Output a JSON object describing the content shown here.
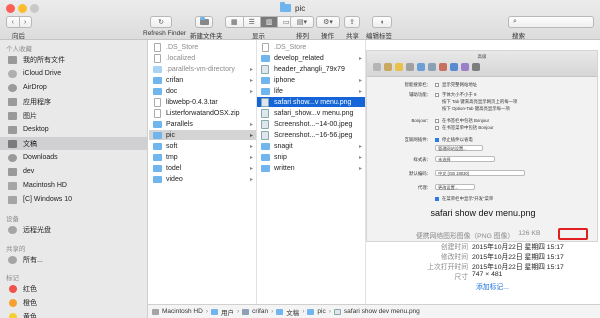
{
  "window": {
    "title": "pic"
  },
  "toolbar": {
    "back_label": "向后",
    "refresh_label": "Refresh Finder",
    "new_folder_label": "新建文件夹",
    "display_label": "显示",
    "arrange_label": "排列",
    "action_label": "操作",
    "share_label": "共享",
    "edit_tags_label": "编辑标签",
    "search_label": "搜索"
  },
  "sidebar": {
    "favorites_title": "个人收藏",
    "favorites": [
      {
        "label": "我的所有文件",
        "icon": "all-files-icon"
      },
      {
        "label": "iCloud Drive",
        "icon": "cloud-icon"
      },
      {
        "label": "AirDrop",
        "icon": "airdrop-icon"
      },
      {
        "label": "应用程序",
        "icon": "applications-icon"
      },
      {
        "label": "图片",
        "icon": "pictures-icon"
      },
      {
        "label": "Desktop",
        "icon": "desktop-icon"
      },
      {
        "label": "文稿",
        "icon": "documents-icon"
      },
      {
        "label": "Downloads",
        "icon": "downloads-icon"
      },
      {
        "label": "dev",
        "icon": "folder-icon"
      },
      {
        "label": "Macintosh HD",
        "icon": "disk-icon"
      },
      {
        "label": "[C] Windows 10",
        "icon": "disk-icon"
      }
    ],
    "devices_title": "设备",
    "devices": [
      {
        "label": "远程光盘",
        "icon": "remote-disc-icon"
      }
    ],
    "shared_title": "共享的",
    "shared": [
      {
        "label": "所有...",
        "icon": "network-icon"
      }
    ],
    "tags_title": "标记",
    "tags": [
      {
        "label": "红色",
        "color": "#f0524c"
      },
      {
        "label": "橙色",
        "color": "#f5a030"
      },
      {
        "label": "黄色",
        "color": "#f5cf32"
      }
    ]
  },
  "columns": {
    "col1": [
      {
        "name": ".DS_Store",
        "kind": "file",
        "dim": true
      },
      {
        "name": ".localized",
        "kind": "file",
        "dim": true
      },
      {
        "name": ".parallels-vm-directory",
        "kind": "folder",
        "dim": true
      },
      {
        "name": "crifan",
        "kind": "folder"
      },
      {
        "name": "doc",
        "kind": "folder"
      },
      {
        "name": "libwebp-0.4.3.tar",
        "kind": "file"
      },
      {
        "name": "ListerforwatandOSX.zip",
        "kind": "file"
      },
      {
        "name": "Parallels",
        "kind": "folder"
      },
      {
        "name": "pic",
        "kind": "folder",
        "selected": true
      },
      {
        "name": "soft",
        "kind": "folder"
      },
      {
        "name": "tmp",
        "kind": "folder"
      },
      {
        "name": "todel",
        "kind": "folder"
      },
      {
        "name": "video",
        "kind": "folder"
      }
    ],
    "col2": [
      {
        "name": ".DS_Store",
        "kind": "file",
        "dim": true
      },
      {
        "name": "develop_related",
        "kind": "folder"
      },
      {
        "name": "header_zhangli_79x79",
        "kind": "img"
      },
      {
        "name": "iphone",
        "kind": "folder"
      },
      {
        "name": "life",
        "kind": "folder"
      },
      {
        "name": "safari show...v menu.png",
        "kind": "img",
        "selected": true
      },
      {
        "name": "safari_show...v menu.png",
        "kind": "img"
      },
      {
        "name": "Screenshot...~14-00.jpeg",
        "kind": "img"
      },
      {
        "name": "Screenshot...~16-56.jpeg",
        "kind": "img"
      },
      {
        "name": "snagit",
        "kind": "folder"
      },
      {
        "name": "snip",
        "kind": "folder"
      },
      {
        "name": "written",
        "kind": "folder"
      }
    ]
  },
  "preview_thumb": {
    "title": "高级",
    "rows": [
      {
        "label": "智能搜索栏：",
        "value": "显示完整网站地址"
      },
      {
        "label": "辅助功能：",
        "value": "字体大小不小于 9"
      },
      {
        "label": "",
        "value": "按下 Tab 键来高亮显示网页上的每一项"
      },
      {
        "label": "",
        "value": "按下 Option-Tab 键高亮显示每一项"
      },
      {
        "label": "Bonjour：",
        "value": "在书签栏中包括 Bonjour"
      },
      {
        "label": "",
        "value": "在书签菜单中包括 Bonjour"
      },
      {
        "label": "互联网插件：",
        "value": "停止插件以省电"
      },
      {
        "label": "",
        "value": "管理网站设置..."
      },
      {
        "label": "样式表：",
        "value": "未选择"
      },
      {
        "label": "默认编码：",
        "value": "中文 (GB 18030)"
      },
      {
        "label": "代理：",
        "value": "更改设置..."
      },
      {
        "label": "",
        "value": "在菜单栏中显示“开发”菜单"
      }
    ]
  },
  "preview": {
    "file_name": "safari show dev menu.png",
    "kind_label": "便携网络图形图像（PNG 图像）",
    "size": "126 KB",
    "created_key": "创建时间",
    "created": "2015年10月22日 星期四 15:17",
    "modified_key": "修改时间",
    "modified": "2015年10月22日 星期四 15:17",
    "opened_key": "上次打开时间",
    "opened": "2015年10月22日 星期四 15:17",
    "dims_key": "尺寸",
    "dims": "747 × 481",
    "more_tags": "添加标记..."
  },
  "pathbar": [
    {
      "label": "Macintosh HD",
      "icon": "disk-icon"
    },
    {
      "label": "用户",
      "icon": "folder-icon"
    },
    {
      "label": "crifan",
      "icon": "home-icon"
    },
    {
      "label": "文稿",
      "icon": "folder-icon"
    },
    {
      "label": "pic",
      "icon": "folder-icon"
    },
    {
      "label": "safari show dev menu.png",
      "icon": "image-file-icon"
    }
  ],
  "colors": {
    "selection_blue": "#1565d8",
    "highlight_red": "#e02020",
    "folder_blue": "#71b5ee"
  }
}
